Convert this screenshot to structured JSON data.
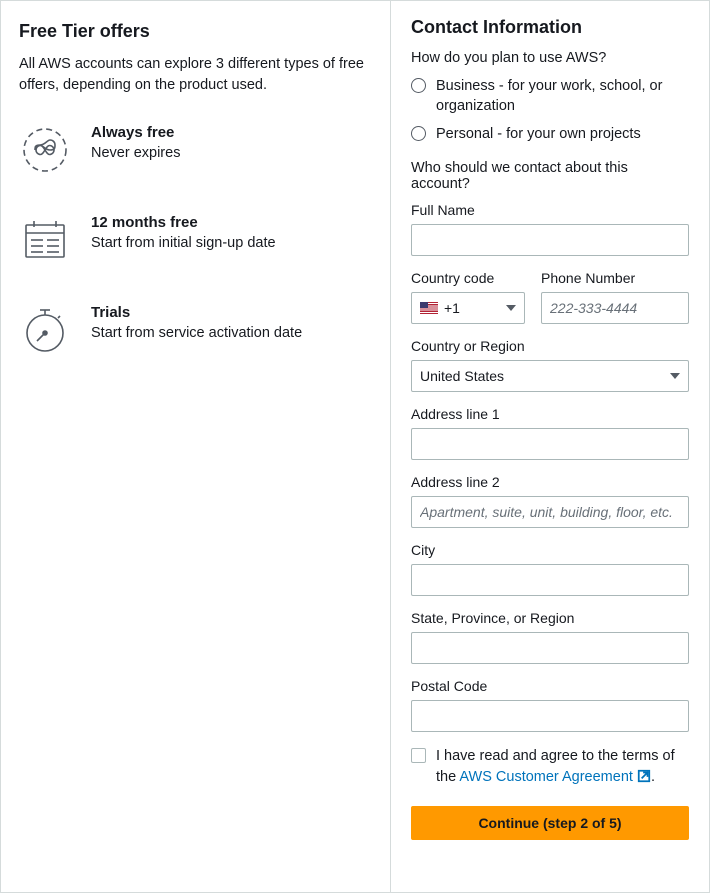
{
  "left": {
    "heading": "Free Tier offers",
    "intro": "All AWS accounts can explore 3 different types of free offers, depending on the product used.",
    "offers": [
      {
        "title": "Always free",
        "sub": "Never expires"
      },
      {
        "title": "12 months free",
        "sub": "Start from initial sign-up date"
      },
      {
        "title": "Trials",
        "sub": "Start from service activation date"
      }
    ]
  },
  "right": {
    "heading": "Contact Information",
    "q1": "How do you plan to use AWS?",
    "radios": [
      "Business - for your work, school, or organization",
      "Personal - for your own projects"
    ],
    "q2": "Who should we contact about this account?",
    "fullname_label": "Full Name",
    "country_code_label": "Country code",
    "country_code_value": "+1",
    "phone_label": "Phone Number",
    "phone_placeholder": "222-333-4444",
    "country_label": "Country or Region",
    "country_value": "United States",
    "addr1_label": "Address line 1",
    "addr2_label": "Address line 2",
    "addr2_placeholder": "Apartment, suite, unit, building, floor, etc.",
    "city_label": "City",
    "state_label": "State, Province, or Region",
    "postal_label": "Postal Code",
    "agree_prefix": "I have read and agree to the terms of the ",
    "agree_link": "AWS Customer Agreement",
    "agree_suffix": ".",
    "continue": "Continue (step 2 of 5)"
  }
}
